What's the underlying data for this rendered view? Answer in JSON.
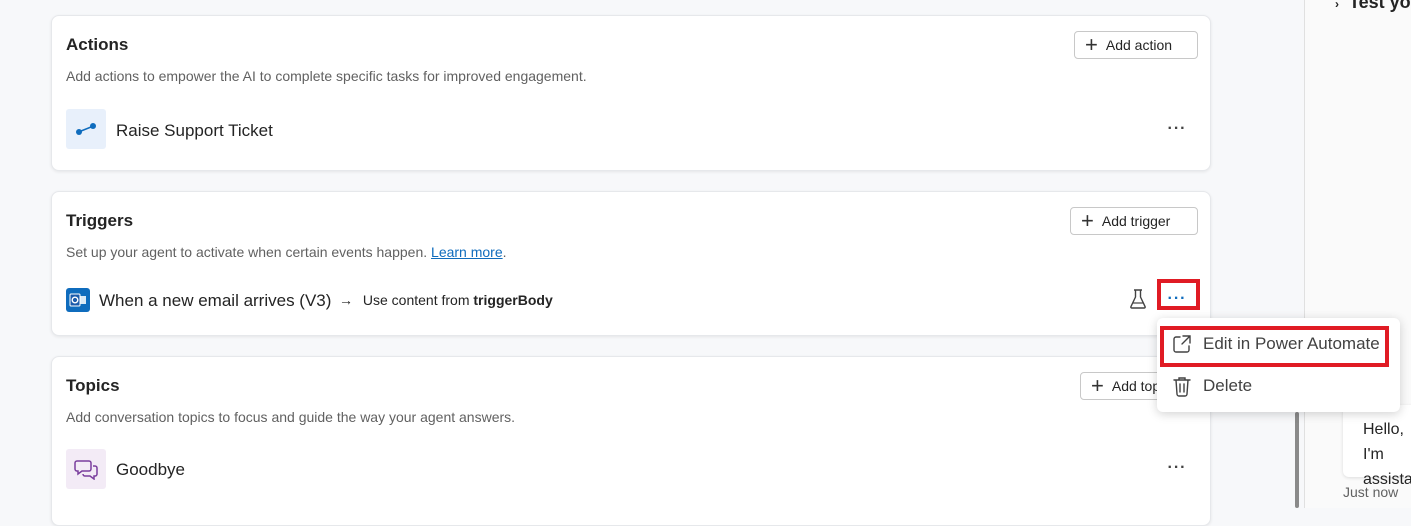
{
  "actions": {
    "title": "Actions",
    "description": "Add actions to empower the AI to complete specific tasks for improved engagement.",
    "add_label": "Add action",
    "items": [
      {
        "label": "Raise Support Ticket",
        "icon": "flow-icon"
      }
    ]
  },
  "triggers": {
    "title": "Triggers",
    "description": "Set up your agent to activate when certain events happen.",
    "learn_more": "Learn more",
    "period": ".",
    "add_label": "Add trigger",
    "items": [
      {
        "label": "When a new email arrives (V3)",
        "arrow": "→",
        "content_prefix": "Use content from",
        "content_value": "triggerBody",
        "icon": "outlook-icon"
      }
    ]
  },
  "topics": {
    "title": "Topics",
    "description": "Add conversation topics to focus and guide the way your agent answers.",
    "add_label": "Add topic",
    "items": [
      {
        "label": "Goodbye",
        "icon": "chat-bubbles-icon"
      }
    ]
  },
  "menu": {
    "items": [
      {
        "label": "Edit in Power Automate",
        "icon": "open-external-icon"
      },
      {
        "label": "Delete",
        "icon": "trash-icon"
      }
    ]
  },
  "more_glyph": "···",
  "side_panel": {
    "title": "Test yo",
    "chat_message": "Hello, I'm assista",
    "timestamp": "Just now"
  },
  "colors": {
    "accent": "#0f6cbd",
    "highlight": "#e01b24"
  }
}
